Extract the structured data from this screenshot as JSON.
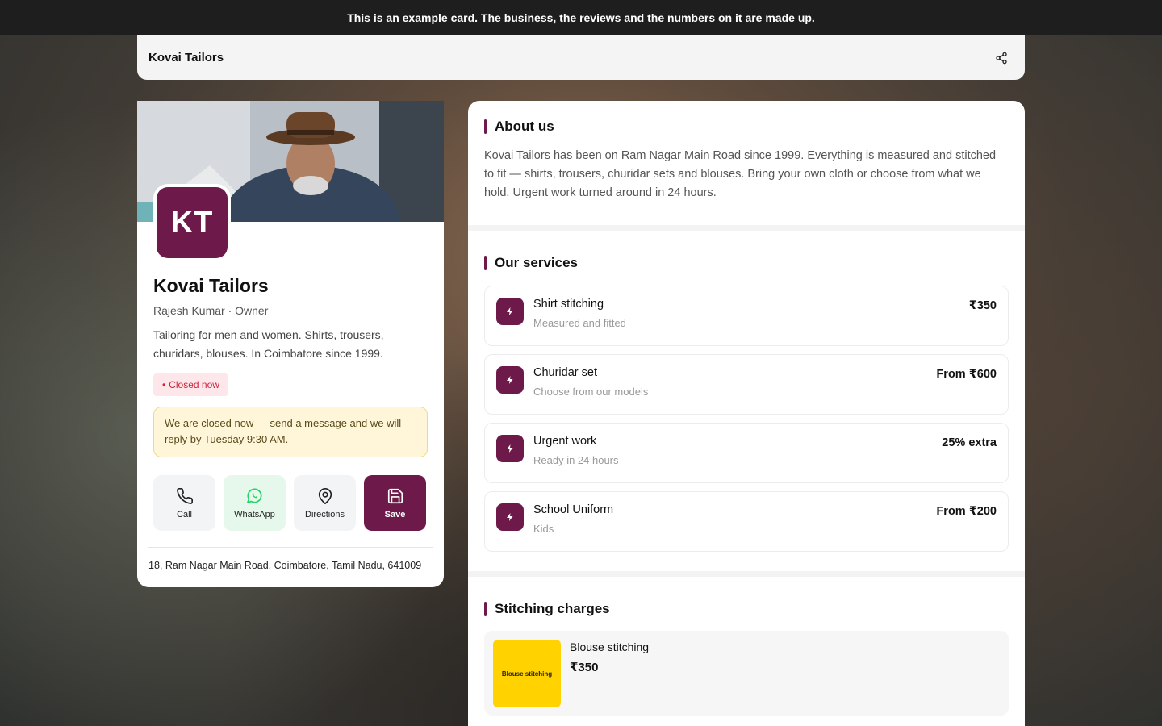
{
  "banner": {
    "text": "This is an example card. The business, the reviews and the numbers on it are made up."
  },
  "topbar": {
    "title": "Kovai Tailors",
    "share_icon": "share-icon"
  },
  "profile": {
    "initials": "KT",
    "name": "Kovai Tailors",
    "owner": "Rajesh Kumar · Owner",
    "tagline": "Tailoring for men and women. Shirts, trousers, churidars, blouses. In Coimbatore since 1999.",
    "status": "Closed now",
    "notice": "We are closed now — send a message and we will reply by Tuesday 9:30 AM.",
    "address": "18, Ram Nagar Main Road, Coimbatore, Tamil Nadu, 641009",
    "actions": [
      {
        "label": "Call",
        "icon": "phone-icon"
      },
      {
        "label": "WhatsApp",
        "icon": "whatsapp-icon"
      },
      {
        "label": "Directions",
        "icon": "map-pin-icon"
      },
      {
        "label": "Save",
        "icon": "save-icon"
      }
    ]
  },
  "about": {
    "title": "About us",
    "text": "Kovai Tailors has been on Ram Nagar Main Road since 1999. Everything is measured and stitched to fit — shirts, trousers, churidar sets and blouses. Bring your own cloth or choose from what we hold. Urgent work turned around in 24 hours."
  },
  "services": {
    "title": "Our services",
    "items": [
      {
        "name": "Shirt stitching",
        "sub": "Measured and fitted",
        "price": "₹350"
      },
      {
        "name": "Churidar set",
        "sub": "Choose from our models",
        "price": "From ₹600"
      },
      {
        "name": "Urgent work",
        "sub": "Ready in 24 hours",
        "price": "25% extra"
      },
      {
        "name": "School Uniform",
        "sub": "Kids",
        "price": "From ₹200"
      }
    ]
  },
  "charges": {
    "title": "Stitching charges",
    "items": [
      {
        "thumb_label": "Blouse stitching",
        "name": "Blouse stitching",
        "price": "₹350"
      }
    ]
  },
  "colors": {
    "brand": "#6d1a4a",
    "status_closed": "#d0243a",
    "whatsapp": "#25d366"
  }
}
